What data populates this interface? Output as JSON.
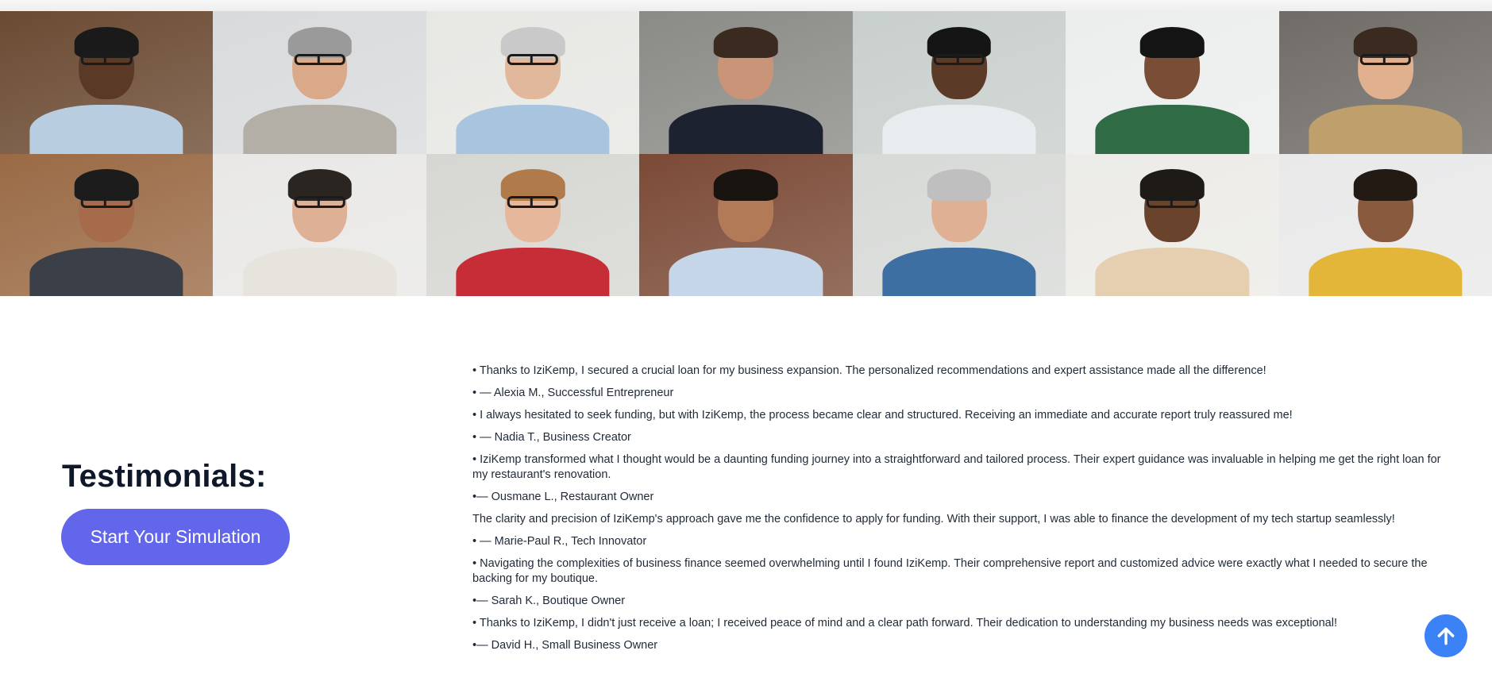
{
  "header": {
    "title": "Testimonials:"
  },
  "cta": {
    "label": "Start Your Simulation"
  },
  "testimonials": [
    "• Thanks to IziKemp, I secured a crucial loan for my business expansion. The personalized recommendations and expert assistance made all the difference!",
    "• — Alexia M., Successful Entrepreneur",
    "• I always hesitated to seek funding, but with IziKemp, the process became clear and structured. Receiving an immediate and accurate report truly reassured me!",
    "• — Nadia T., Business Creator",
    "• IziKemp transformed what I thought would be a daunting funding journey into a straightforward and tailored process. Their expert guidance was invaluable in helping me get the right loan for my restaurant's renovation.",
    "•— Ousmane L., Restaurant Owner",
    "The clarity and precision of IziKemp's approach gave me the confidence to apply for funding. With their support, I was able to finance the development of my tech startup seamlessly!",
    "• — Marie-Paul R., Tech Innovator",
    "• Navigating the complexities of business finance seemed overwhelming until I found IziKemp. Their comprehensive report and customized advice were exactly what I needed to secure the backing for my boutique.",
    "•— Sarah K., Boutique Owner",
    "• Thanks to IziKemp, I didn't just receive a loan; I received peace of mind and a clear path forward. Their dedication to understanding my business needs was exceptional!",
    "•— David H., Small Business Owner"
  ],
  "photos": [
    {
      "bg": "#6b4a32",
      "skin": "#5a3a26",
      "hair": "#1a1a1a",
      "shirt": "#b9cde0",
      "glasses": true
    },
    {
      "bg": "#d8dadc",
      "skin": "#d9a98a",
      "hair": "#9a9a9a",
      "shirt": "#b3aea6",
      "glasses": true
    },
    {
      "bg": "#e7e7e4",
      "skin": "#e2b89c",
      "hair": "#c9c9c9",
      "shirt": "#a9c4de",
      "glasses": true
    },
    {
      "bg": "#8a8a86",
      "skin": "#c99478",
      "hair": "#3a2a1f",
      "shirt": "#1d2230",
      "glasses": false
    },
    {
      "bg": "#c8cfcc",
      "skin": "#5b3a28",
      "hair": "#151515",
      "shirt": "#e9ecef",
      "glasses": true
    },
    {
      "bg": "#eceeee",
      "skin": "#7a4e36",
      "hair": "#141414",
      "shirt": "#2f6b44",
      "glasses": false
    },
    {
      "bg": "#6f6b66",
      "skin": "#e0b08f",
      "hair": "#3b2a20",
      "shirt": "#bf9f6c",
      "glasses": true
    },
    {
      "bg": "#9a6a45",
      "skin": "#a56b4a",
      "hair": "#1c1c1c",
      "shirt": "#3b3f48",
      "glasses": true
    },
    {
      "bg": "#e9e8e6",
      "skin": "#deb197",
      "hair": "#2a2520",
      "shirt": "#e6e4dc",
      "glasses": true
    },
    {
      "bg": "#d6d6d2",
      "skin": "#e6b79a",
      "hair": "#b07a4a",
      "shirt": "#c62d36",
      "glasses": true
    },
    {
      "bg": "#7b4a36",
      "skin": "#b37a58",
      "hair": "#1a1410",
      "shirt": "#c5d6e8",
      "glasses": false
    },
    {
      "bg": "#d7d9d7",
      "skin": "#e0b094",
      "hair": "#bfbfbf",
      "shirt": "#3d6fa3",
      "glasses": false
    },
    {
      "bg": "#ecebe7",
      "skin": "#6a432d",
      "hair": "#1e1a16",
      "shirt": "#e5cfb0",
      "glasses": true
    },
    {
      "bg": "#e9e9ea",
      "skin": "#8a5a3e",
      "hair": "#241a14",
      "shirt": "#e3b63a",
      "glasses": false
    }
  ],
  "scroll_top": {
    "icon": "arrow-up-icon",
    "color": "#3b82f6"
  },
  "colors": {
    "accent": "#6266ea",
    "title": "#0f172a"
  }
}
